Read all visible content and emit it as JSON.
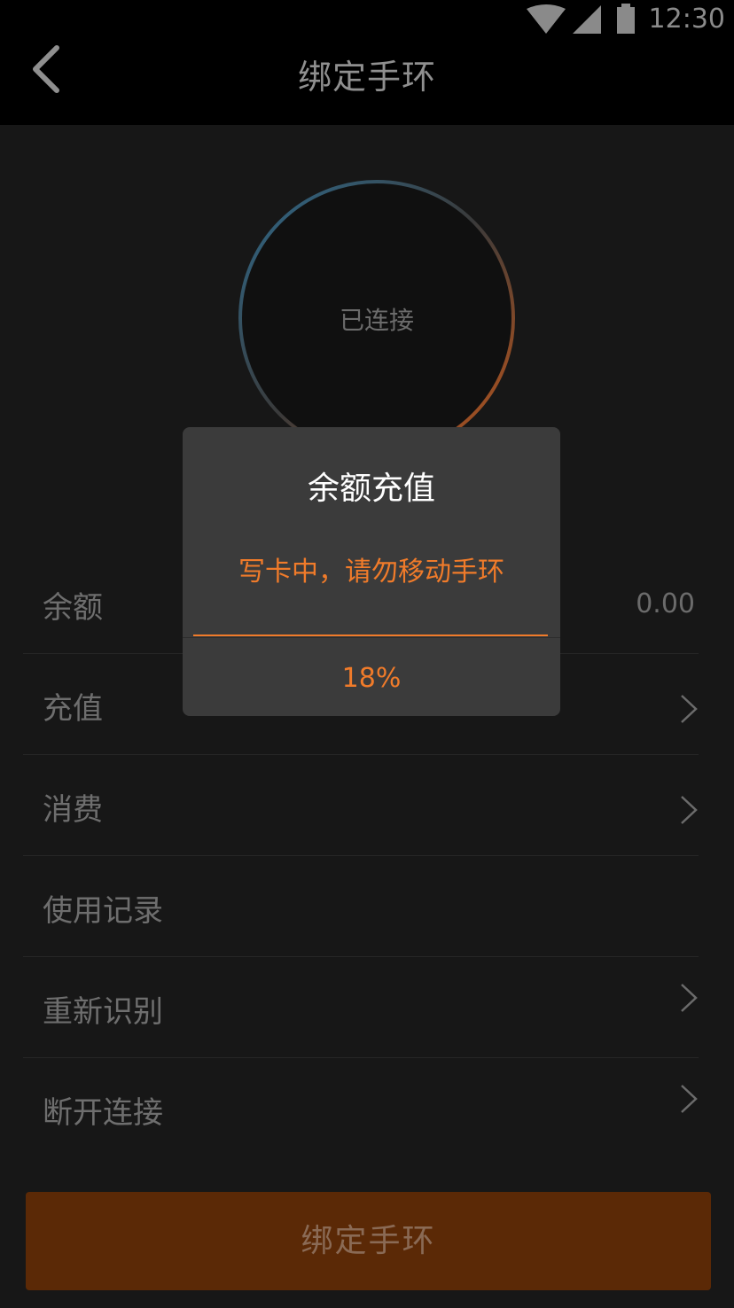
{
  "status_bar": {
    "time": "12:30",
    "icons": [
      "wifi-icon",
      "cell-signal-icon",
      "battery-icon"
    ]
  },
  "header": {
    "title": "绑定手环",
    "back_icon": "chevron-left-icon"
  },
  "device": {
    "status_text": "已连接"
  },
  "list": {
    "balance_label": "余额",
    "balance_value": "0.00",
    "items": [
      {
        "label": "充值"
      },
      {
        "label": "消费"
      },
      {
        "label": "使用记录"
      },
      {
        "label": "重新识别"
      },
      {
        "label": "断开连接"
      }
    ]
  },
  "bind_button": {
    "label": "绑定手环"
  },
  "dialog": {
    "title": "余额充值",
    "message": "写卡中，请勿移动手环",
    "progress_text": "18%",
    "progress_value": 0.18
  },
  "colors": {
    "accent": "#f07b2a",
    "button_bg": "#5b2906",
    "background": "#171717",
    "dialog_bg": "#3b3b3b",
    "ring_gradient_start": "#2f6a8c",
    "ring_gradient_end": "#c0561a"
  }
}
